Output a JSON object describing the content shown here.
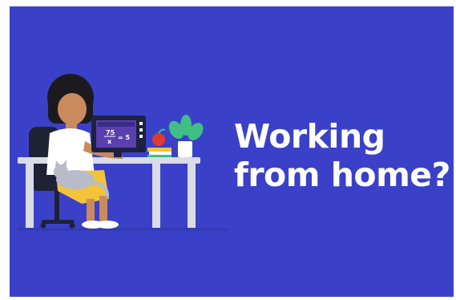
{
  "headline": {
    "line1": "Working",
    "line2": "from home?"
  },
  "screen": {
    "numerator": "75",
    "denominator": "x",
    "equals": "= 5"
  },
  "colors": {
    "background": "#3a41c8",
    "headline": "#ffffff",
    "desk": "#d9dce8",
    "shirt": "#ffffff",
    "skirt": "#f3c43a",
    "skin": "#c98a5d",
    "hair": "#1b1b1f",
    "chair": "#1f2235",
    "monitor": "#1e2140",
    "apple": "#e0392f",
    "plant": "#3fbf86",
    "cat": "#b8bcc8"
  },
  "icons": {
    "scene": "woman-working-at-desk-illustration",
    "pet": "cat-icon",
    "fruit": "apple-icon",
    "plant": "potted-plant-icon",
    "books": "book-stack-icon"
  }
}
